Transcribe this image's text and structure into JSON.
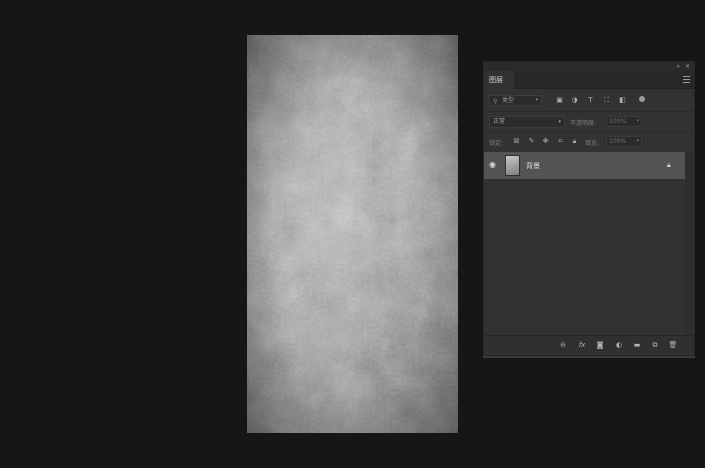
{
  "panel": {
    "tab_label": "图层",
    "filter": {
      "placeholder": "类型",
      "icons": [
        "image-filter-icon",
        "adjustment-filter-icon",
        "type-filter-icon",
        "shape-filter-icon",
        "smart-object-filter-icon",
        "filter-toggle-icon"
      ]
    },
    "blend_mode": "正常",
    "opacity_label": "不透明度:",
    "opacity_value": "100%",
    "lock_label": "锁定:",
    "fill_label": "填充:",
    "fill_value": "100%",
    "type_glyph": "T"
  },
  "layers": [
    {
      "name": "背景",
      "visible": true,
      "locked": true
    }
  ],
  "bottom_icons": [
    "link-layers-icon",
    "fx-icon",
    "add-mask-icon",
    "adjustment-layer-icon",
    "new-group-icon",
    "new-layer-icon",
    "delete-layer-icon"
  ],
  "fx_label": "fx",
  "colors": {
    "background": "#161616",
    "panel": "#323232",
    "selected_layer": "#545454"
  }
}
